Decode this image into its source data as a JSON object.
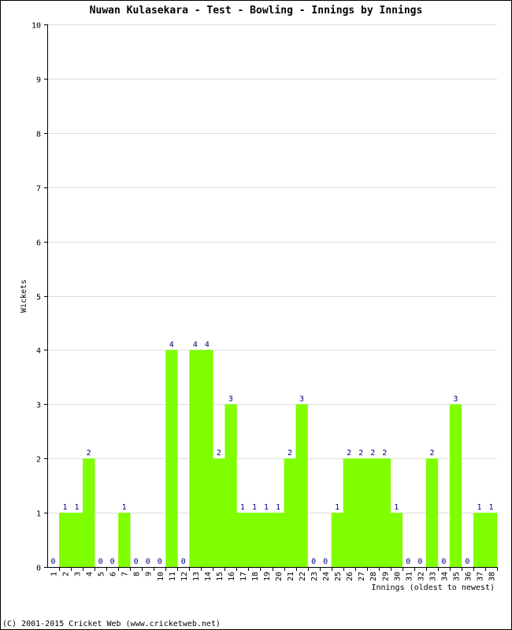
{
  "chart_data": {
    "type": "bar",
    "title": "Nuwan Kulasekara - Test - Bowling - Innings by Innings",
    "xlabel": "Innings (oldest to newest)",
    "ylabel": "Wickets",
    "ylim": [
      0,
      10
    ],
    "yticks": [
      "0",
      "1",
      "2",
      "3",
      "4",
      "5",
      "6",
      "7",
      "8",
      "9",
      "10"
    ],
    "grid": true,
    "bar_color": "#80ff00",
    "label_color": "#000080",
    "categories": [
      "1",
      "2",
      "3",
      "4",
      "5",
      "6",
      "7",
      "8",
      "9",
      "10",
      "11",
      "12",
      "13",
      "14",
      "15",
      "16",
      "17",
      "18",
      "19",
      "20",
      "21",
      "22",
      "23",
      "24",
      "25",
      "26",
      "27",
      "28",
      "29",
      "30",
      "31",
      "32",
      "33",
      "34",
      "35",
      "36",
      "37",
      "38"
    ],
    "values": [
      0,
      1,
      1,
      2,
      0,
      0,
      1,
      0,
      0,
      0,
      4,
      0,
      4,
      4,
      2,
      3,
      1,
      1,
      1,
      1,
      2,
      3,
      0,
      0,
      1,
      2,
      2,
      2,
      2,
      1,
      0,
      0,
      2,
      0,
      3,
      0,
      1,
      1
    ]
  },
  "footer": "(C) 2001-2015 Cricket Web (www.cricketweb.net)"
}
